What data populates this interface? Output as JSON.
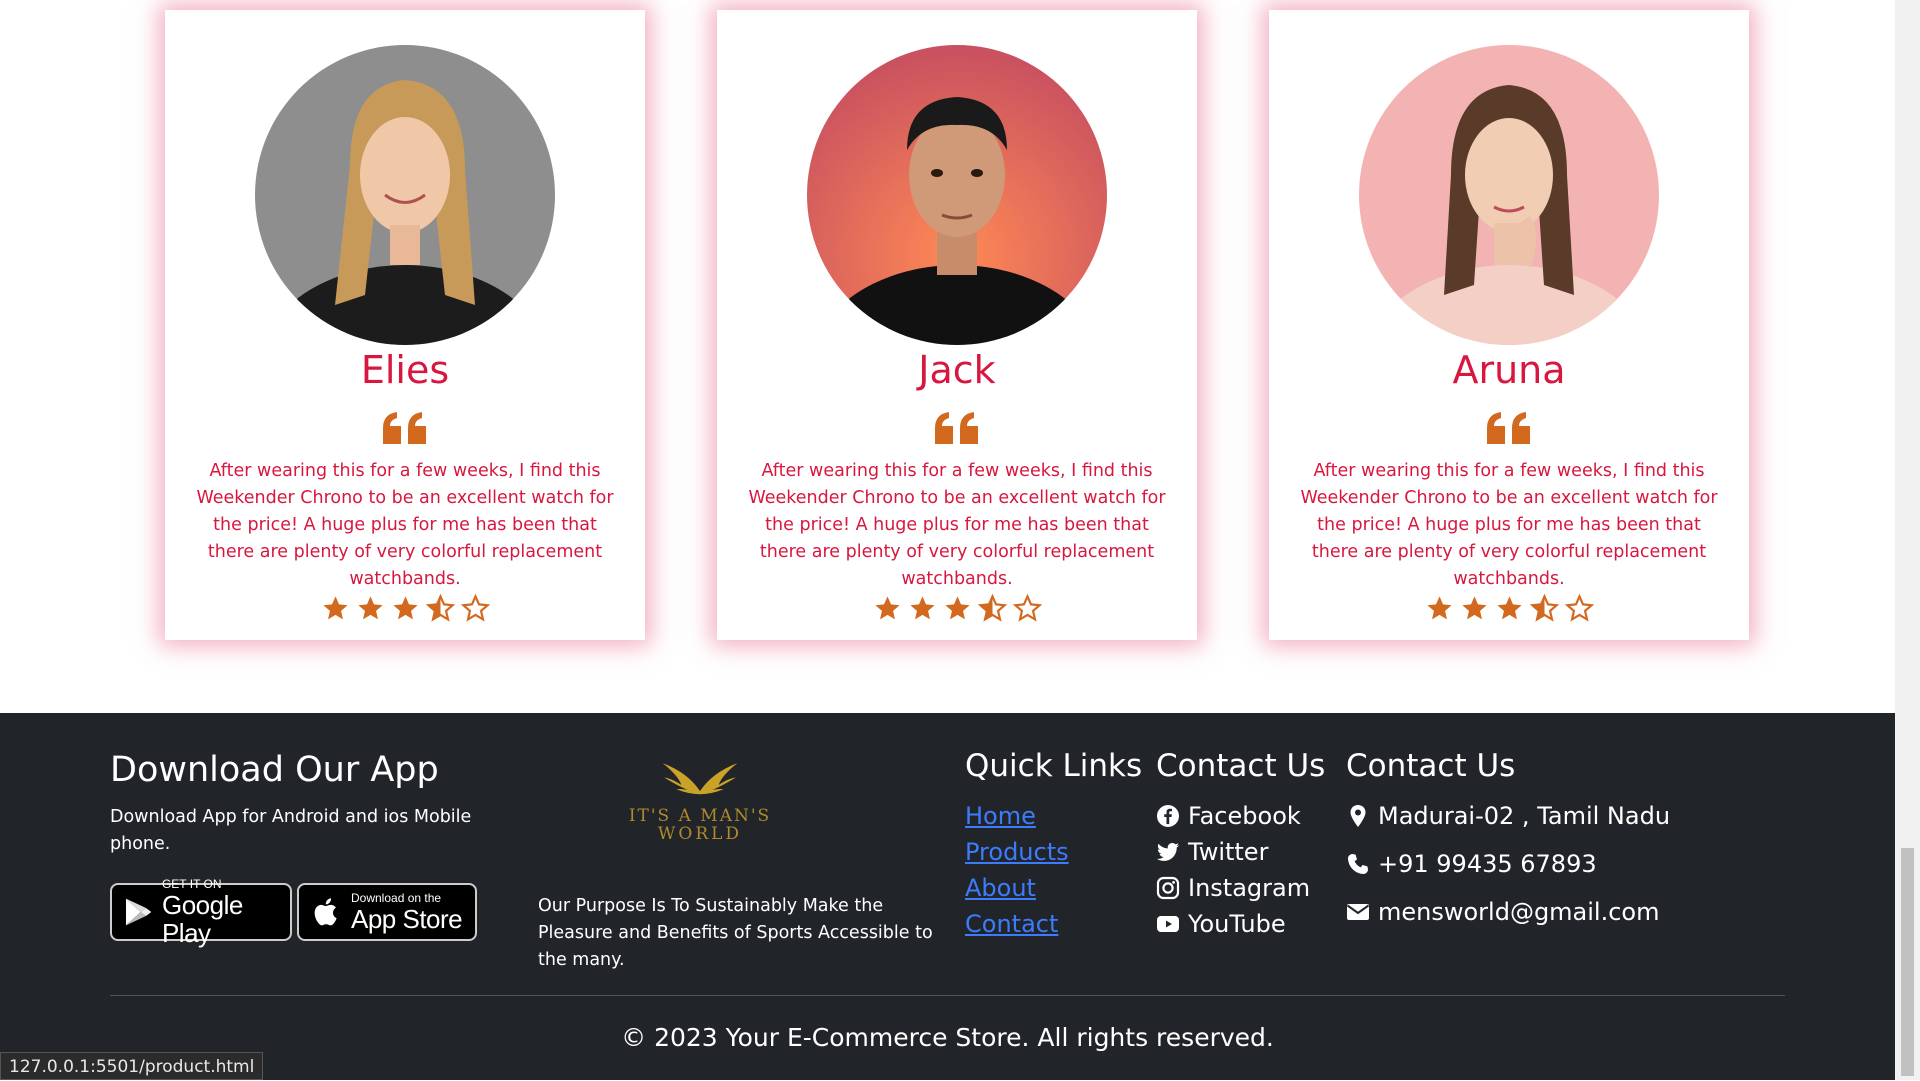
{
  "testimonials": [
    {
      "name": "Elies",
      "text": "After wearing this for a few weeks, I find this Weekender Chrono to be an excellent watch for the price! A huge plus for me has been that there are plenty of very colorful replacement watchbands.",
      "rating": 3.5,
      "max_rating": 5,
      "avatar_bg": "#8e8e8e"
    },
    {
      "name": "Jack",
      "text": "After wearing this for a few weeks, I find this Weekender Chrono to be an excellent watch for the price! A huge plus for me has been that there are plenty of very colorful replacement watchbands.",
      "rating": 3.5,
      "max_rating": 5,
      "avatar_bg": "#e0604f"
    },
    {
      "name": "Aruna",
      "text": "After wearing this for a few weeks, I find this Weekender Chrono to be an excellent watch for the price! A huge plus for me has been that there are plenty of very colorful replacement watchbands.",
      "rating": 3.5,
      "max_rating": 5,
      "avatar_bg": "#f4b3b3"
    }
  ],
  "footer": {
    "download": {
      "title": "Download Our App",
      "text": "Download App for Android and ios Mobile phone.",
      "google_small": "GET IT ON",
      "google_big": "Google Play",
      "apple_small": "Download on the",
      "apple_big": "App Store"
    },
    "brand": {
      "logo_line1": "It's a Man's",
      "logo_line2": "World",
      "purpose": "Our Purpose Is To Sustainably Make the Pleasure and Benefits of Sports Accessible to the many."
    },
    "quick_links": {
      "title": "Quick Links",
      "items": [
        "Home",
        "Products",
        "About",
        "Contact"
      ]
    },
    "social": {
      "title": "Contact Us",
      "items": [
        {
          "label": "Facebook",
          "icon": "facebook-icon"
        },
        {
          "label": "Twitter",
          "icon": "twitter-icon"
        },
        {
          "label": "Instagram",
          "icon": "instagram-icon"
        },
        {
          "label": "YouTube",
          "icon": "youtube-icon"
        }
      ]
    },
    "contact": {
      "title": "Contact Us",
      "address": "Madurai-02 , Tamil Nadu",
      "phone": "+91 99435 67893",
      "email": "mensworld@gmail.com"
    },
    "copyright": "© 2023 Your E-Commerce Store. All rights reserved."
  },
  "status_url": "127.0.0.1:5501/product.html",
  "colors": {
    "accent": "#d8173f",
    "star": "#d2691e",
    "footer_bg": "#212529",
    "link": "#3d7bfd",
    "gold": "#c9a227"
  }
}
